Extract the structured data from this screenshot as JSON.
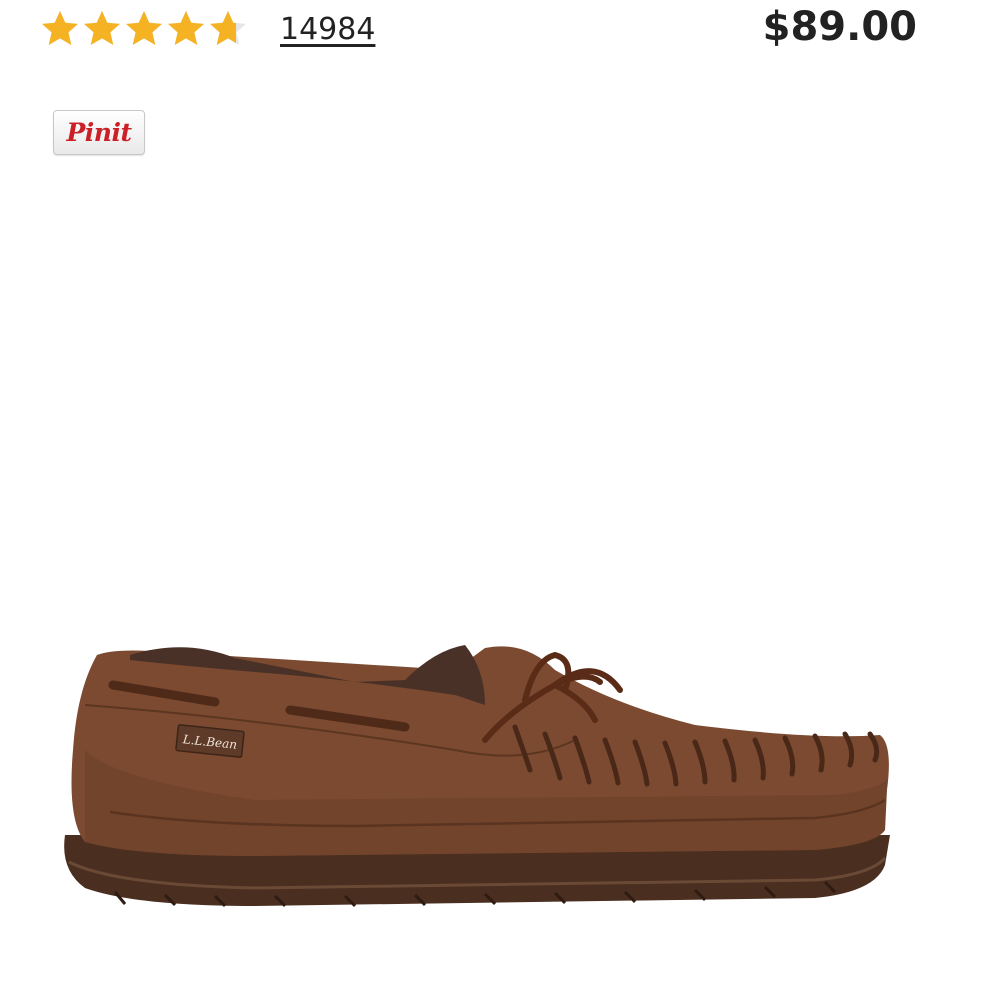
{
  "rating": {
    "value": 4.7,
    "max": 5,
    "review_count": "14984",
    "star_color": "#f5b324",
    "empty_color": "#e6e6e6"
  },
  "price": "$89.00",
  "pin_button": {
    "label": "Pinit",
    "color": "#cb2027"
  },
  "product_image": {
    "brand_tag": "L.L.Bean"
  }
}
